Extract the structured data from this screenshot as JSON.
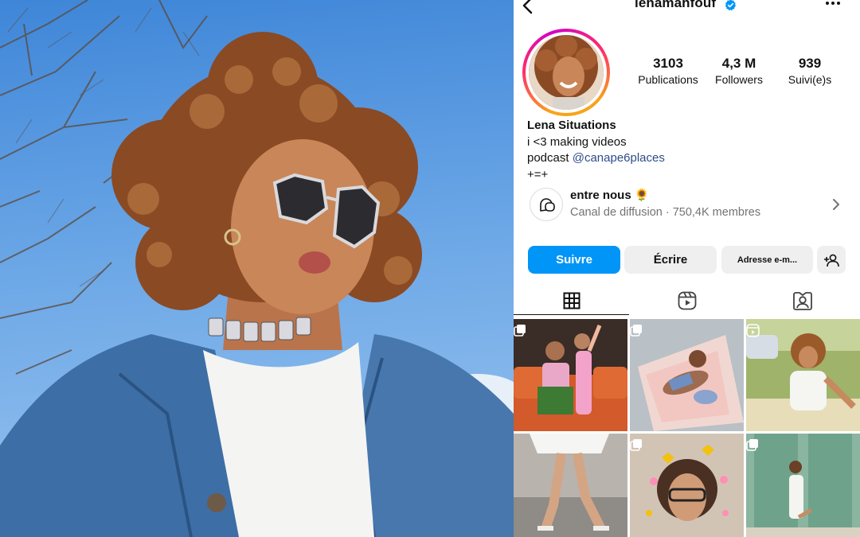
{
  "profile": {
    "username": "lenamahfouf",
    "verified_color": "#0095f6",
    "stats": [
      {
        "value": "3103",
        "label": "Publications"
      },
      {
        "value": "4,3 M",
        "label": "Followers"
      },
      {
        "value": "939",
        "label": "Suivi(e)s"
      }
    ],
    "bio": {
      "name": "Lena Situations",
      "line1": "i <3 making videos",
      "line2_prefix": "podcast ",
      "mention": "@canape6places",
      "line3": "+=+"
    },
    "channel": {
      "title": "entre nous 🌻",
      "subtitle": "Canal de diffusion · 750,4K membres"
    },
    "buttons": {
      "follow": "Suivre",
      "message": "Écrire",
      "email": "Adresse e-m..."
    },
    "accent_color": "#0095f6"
  },
  "tabs": [
    {
      "icon": "grid-icon",
      "active": true
    },
    {
      "icon": "reels-icon",
      "active": false
    },
    {
      "icon": "tagged-icon",
      "active": false
    }
  ],
  "posts": [
    {
      "kind": "carousel",
      "icon": "carousel-icon"
    },
    {
      "kind": "carousel",
      "icon": "carousel-icon"
    },
    {
      "kind": "reel",
      "icon": "reel-icon"
    },
    {
      "kind": "image",
      "icon": ""
    },
    {
      "kind": "carousel",
      "icon": "carousel-icon"
    },
    {
      "kind": "carousel",
      "icon": "carousel-icon"
    }
  ]
}
